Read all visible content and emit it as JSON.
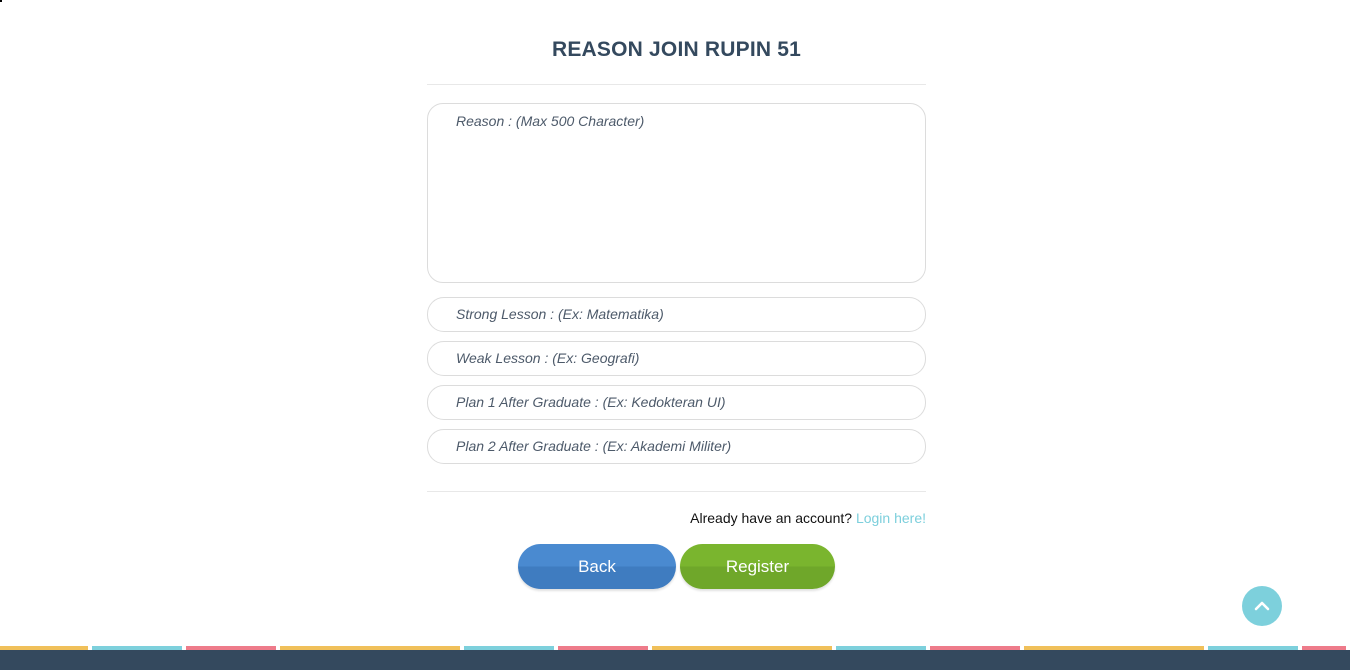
{
  "form": {
    "title": "REASON JOIN RUPIN 51",
    "reason_placeholder": "Reason : (Max 500 Character)",
    "strong_lesson_placeholder": "Strong Lesson : (Ex: Matematika)",
    "weak_lesson_placeholder": "Weak Lesson : (Ex: Geografi)",
    "plan1_placeholder": "Plan 1 After Graduate : (Ex: Kedokteran UI)",
    "plan2_placeholder": "Plan 2 After Graduate : (Ex: Akademi Militer)"
  },
  "login": {
    "prompt": "Already have an account? ",
    "link_label": "Login here!"
  },
  "buttons": {
    "back_label": "Back",
    "register_label": "Register"
  },
  "scroll_top": {
    "icon": "chevron-up-icon"
  },
  "colors": {
    "title": "#34495e",
    "link": "#7ccfdc",
    "back_button": "#4a8ad0",
    "register_button": "#7ab52e",
    "scroll_top": "#7dd0dc",
    "footer": "#34495e",
    "stripe_yellow": "#f0c05a",
    "stripe_teal": "#7dd0dc",
    "stripe_pink": "#ee7b8a"
  }
}
